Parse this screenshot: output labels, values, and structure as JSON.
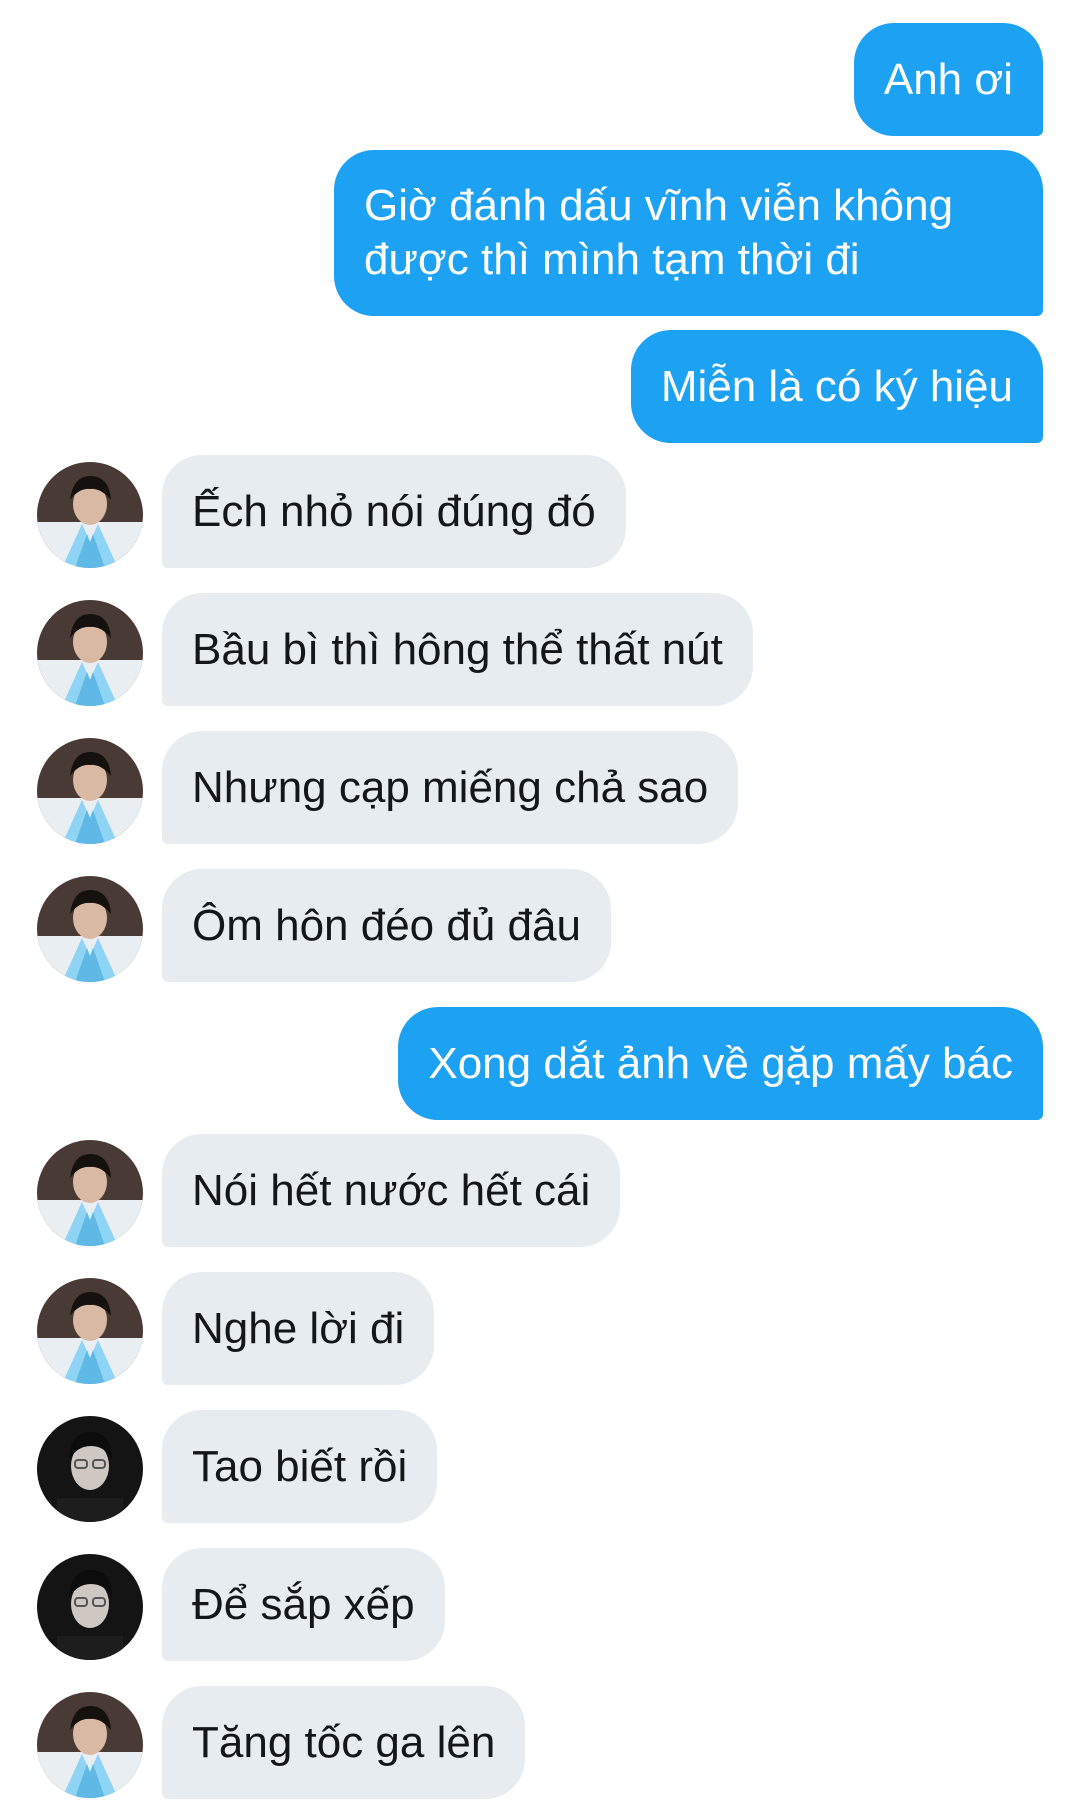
{
  "colors": {
    "outgoing_bubble": "#1da1f2",
    "outgoing_text": "#ffffff",
    "incoming_bubble": "#e6ecf0",
    "incoming_text": "#14171a",
    "background": "#ffffff"
  },
  "messages": [
    {
      "direction": "out",
      "text": "Anh ơi"
    },
    {
      "direction": "out",
      "text": "Giờ đánh dấu vĩnh viễn không được thì mình tạm thời đi"
    },
    {
      "direction": "out",
      "text": "Miễn là có ký hiệu"
    },
    {
      "direction": "in",
      "avatar": "avatar-hanbok-icon",
      "text": "Ếch nhỏ nói đúng đó"
    },
    {
      "direction": "in",
      "avatar": "avatar-hanbok-icon",
      "text": "Bầu bì thì hông thể thất nút"
    },
    {
      "direction": "in",
      "avatar": "avatar-hanbok-icon",
      "text": "Nhưng cạp miếng chả sao"
    },
    {
      "direction": "in",
      "avatar": "avatar-hanbok-icon",
      "text": "Ôm hôn đéo đủ đâu"
    },
    {
      "direction": "out",
      "text": "Xong dắt ảnh về gặp mấy bác"
    },
    {
      "direction": "in",
      "avatar": "avatar-hanbok-icon",
      "text": "Nói hết nước hết cái"
    },
    {
      "direction": "in",
      "avatar": "avatar-hanbok-icon",
      "text": "Nghe lời đi"
    },
    {
      "direction": "in",
      "avatar": "avatar-dark-icon",
      "text": "Tao biết rồi"
    },
    {
      "direction": "in",
      "avatar": "avatar-dark-icon",
      "text": "Để sắp xếp"
    },
    {
      "direction": "in",
      "avatar": "avatar-hanbok-icon",
      "text": "Tăng tốc ga lên"
    }
  ]
}
